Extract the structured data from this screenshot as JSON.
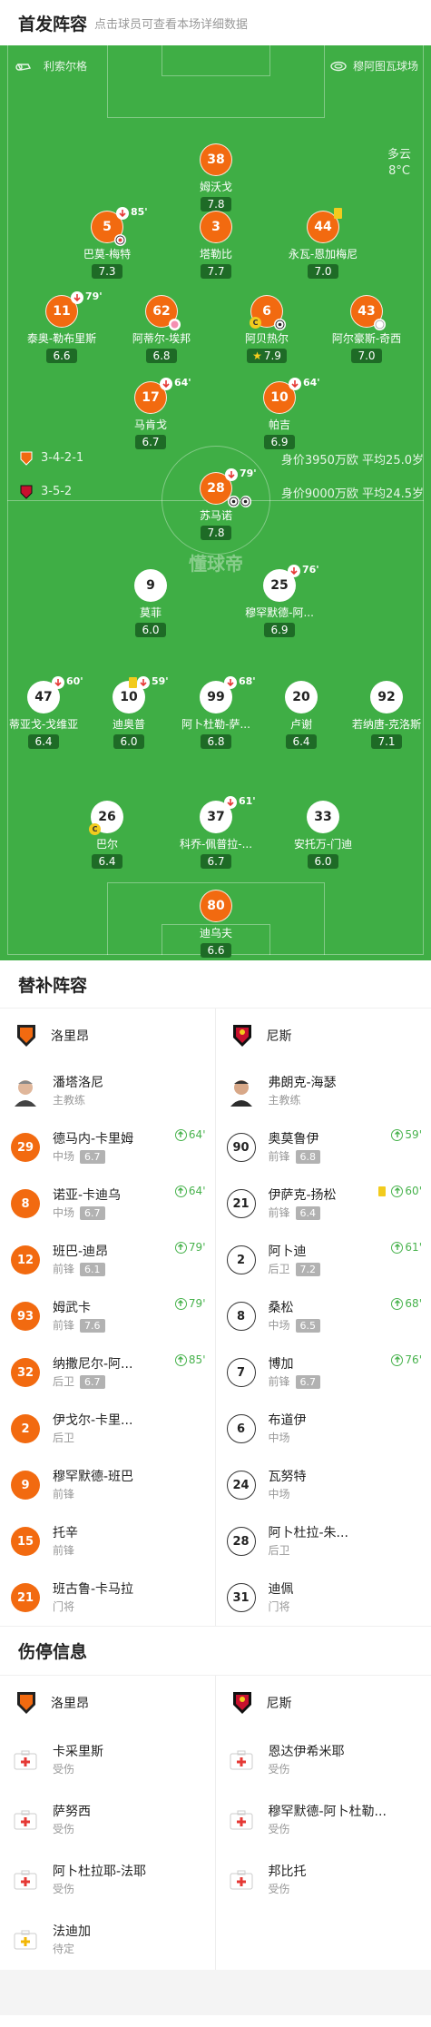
{
  "lineup": {
    "title": "首发阵容",
    "subtitle": "点击球员可查看本场详细数据"
  },
  "home_team": "利索尔格",
  "away_team": "穆阿图瓦球场",
  "weather": {
    "desc": "多云",
    "temp": "8°C"
  },
  "home_formation": {
    "label": "3-4-2-1",
    "value": "身价3950万欧 平均25.0岁"
  },
  "away_formation": {
    "label": "3-5-2",
    "value": "身价9000万欧 平均24.5岁"
  },
  "watermark": "懂球帝",
  "home_players": [
    {
      "num": "38",
      "name": "姆沃戈",
      "rating": "7.8"
    },
    {
      "num": "5",
      "name": "巴莫-梅特",
      "rating": "7.3",
      "sub": "85'"
    },
    {
      "num": "3",
      "name": "塔勒比",
      "rating": "7.7"
    },
    {
      "num": "44",
      "name": "永瓦-恩加梅尼",
      "rating": "7.0"
    },
    {
      "num": "11",
      "name": "泰奥-勒布里斯",
      "rating": "6.6",
      "sub": "79'"
    },
    {
      "num": "62",
      "name": "阿蒂尔-埃邦",
      "rating": "6.8"
    },
    {
      "num": "6",
      "name": "阿贝热尔",
      "rating": "7.9"
    },
    {
      "num": "43",
      "name": "阿尔豪斯-奇西",
      "rating": "7.0"
    },
    {
      "num": "17",
      "name": "马肯戈",
      "rating": "6.7",
      "sub": "64'"
    },
    {
      "num": "10",
      "name": "帕吉",
      "rating": "6.9",
      "sub": "64'"
    },
    {
      "num": "28",
      "name": "苏马诺",
      "rating": "7.8",
      "sub": "79'"
    }
  ],
  "away_players": [
    {
      "num": "9",
      "name": "莫菲",
      "rating": "6.0"
    },
    {
      "num": "25",
      "name": "穆罕默德-阿...",
      "rating": "6.9",
      "sub": "76'"
    },
    {
      "num": "47",
      "name": "蒂亚戈-戈维亚",
      "rating": "6.4",
      "sub": "60'"
    },
    {
      "num": "10",
      "name": "迪奥普",
      "rating": "6.0",
      "sub": "59'"
    },
    {
      "num": "99",
      "name": "阿卜杜勒-萨...",
      "rating": "6.8",
      "sub": "68'"
    },
    {
      "num": "20",
      "name": "卢谢",
      "rating": "6.4"
    },
    {
      "num": "92",
      "name": "若纳唐-克洛斯",
      "rating": "7.1"
    },
    {
      "num": "26",
      "name": "巴尔",
      "rating": "6.4"
    },
    {
      "num": "37",
      "name": "科乔-佩普拉-...",
      "rating": "6.7",
      "sub": "61'"
    },
    {
      "num": "33",
      "name": "安托万-门迪",
      "rating": "6.0"
    },
    {
      "num": "80",
      "name": "迪乌夫",
      "rating": "6.6"
    }
  ],
  "subs": {
    "title": "替补阵容",
    "home": {
      "team": "洛里昂",
      "coach": {
        "name": "潘塔洛尼",
        "role": "主教练"
      },
      "players": [
        {
          "num": "29",
          "name": "德马内-卡里姆",
          "pos": "中场",
          "rating": "6.7",
          "in": "64'"
        },
        {
          "num": "8",
          "name": "诺亚-卡迪乌",
          "pos": "中场",
          "rating": "6.7",
          "in": "64'"
        },
        {
          "num": "12",
          "name": "班巴-迪昂",
          "pos": "前锋",
          "rating": "6.1",
          "in": "79'"
        },
        {
          "num": "93",
          "name": "姆武卡",
          "pos": "前锋",
          "rating": "7.6",
          "in": "79'"
        },
        {
          "num": "32",
          "name": "纳撒尼尔-阿...",
          "pos": "后卫",
          "rating": "6.7",
          "in": "85'"
        },
        {
          "num": "2",
          "name": "伊戈尔-卡里...",
          "pos": "后卫"
        },
        {
          "num": "9",
          "name": "穆罕默德-班巴",
          "pos": "前锋"
        },
        {
          "num": "15",
          "name": "托辛",
          "pos": "前锋"
        },
        {
          "num": "21",
          "name": "班古鲁-卡马拉",
          "pos": "门将"
        }
      ]
    },
    "away": {
      "team": "尼斯",
      "coach": {
        "name": "弗朗克-海瑟",
        "role": "主教练"
      },
      "players": [
        {
          "num": "90",
          "name": "奥莫鲁伊",
          "pos": "前锋",
          "rating": "6.8",
          "in": "59'"
        },
        {
          "num": "21",
          "name": "伊萨克-扬松",
          "pos": "前锋",
          "rating": "6.4",
          "in": "60'"
        },
        {
          "num": "2",
          "name": "阿卜迪",
          "pos": "后卫",
          "rating": "7.2",
          "in": "61'"
        },
        {
          "num": "8",
          "name": "桑松",
          "pos": "中场",
          "rating": "6.5",
          "in": "68'"
        },
        {
          "num": "7",
          "name": "博加",
          "pos": "前锋",
          "rating": "6.7",
          "in": "76'"
        },
        {
          "num": "6",
          "name": "布道伊",
          "pos": "中场"
        },
        {
          "num": "24",
          "name": "瓦努特",
          "pos": "中场"
        },
        {
          "num": "28",
          "name": "阿卜杜拉-朱...",
          "pos": "后卫"
        },
        {
          "num": "31",
          "name": "迪佩",
          "pos": "门将"
        }
      ]
    }
  },
  "injuries": {
    "title": "伤停信息",
    "home": {
      "team": "洛里昂",
      "players": [
        {
          "name": "卡采里斯",
          "status": "受伤"
        },
        {
          "name": "萨努西",
          "status": "受伤"
        },
        {
          "name": "阿卜杜拉耶-法耶",
          "status": "受伤"
        },
        {
          "name": "法迪加",
          "status": "待定"
        }
      ]
    },
    "away": {
      "team": "尼斯",
      "players": [
        {
          "name": "恩达伊希米耶",
          "status": "受伤"
        },
        {
          "name": "穆罕默德-阿卜杜勒...",
          "status": "受伤"
        },
        {
          "name": "邦比托",
          "status": "受伤"
        }
      ]
    }
  },
  "colors": {
    "pitch": "#3fae45",
    "home": "#f26a10",
    "sub_green": "#47b24c",
    "card": "#f2cb1d"
  }
}
